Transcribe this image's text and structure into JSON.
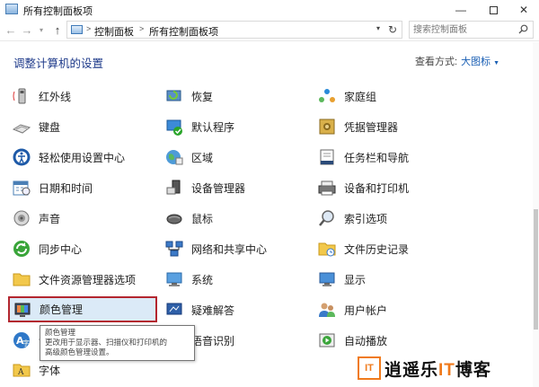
{
  "window": {
    "title": "所有控制面板项"
  },
  "address": {
    "crumbs": [
      "控制面板",
      "所有控制面板项"
    ],
    "search_placeholder": "搜索控制面板"
  },
  "header": {
    "title": "调整计算机的设置",
    "view_label": "查看方式:",
    "view_value": "大图标"
  },
  "items": [
    {
      "label": "红外线",
      "icon": "infrared-icon"
    },
    {
      "label": "恢复",
      "icon": "recovery-icon"
    },
    {
      "label": "家庭组",
      "icon": "homegroup-icon"
    },
    {
      "label": "键盘",
      "icon": "keyboard-icon"
    },
    {
      "label": "默认程序",
      "icon": "default-programs-icon"
    },
    {
      "label": "凭据管理器",
      "icon": "credential-manager-icon"
    },
    {
      "label": "轻松使用设置中心",
      "icon": "ease-of-access-icon"
    },
    {
      "label": "区域",
      "icon": "region-icon"
    },
    {
      "label": "任务栏和导航",
      "icon": "taskbar-icon"
    },
    {
      "label": "日期和时间",
      "icon": "date-time-icon"
    },
    {
      "label": "设备管理器",
      "icon": "device-manager-icon"
    },
    {
      "label": "设备和打印机",
      "icon": "devices-printers-icon"
    },
    {
      "label": "声音",
      "icon": "sound-icon"
    },
    {
      "label": "鼠标",
      "icon": "mouse-icon"
    },
    {
      "label": "索引选项",
      "icon": "indexing-icon"
    },
    {
      "label": "同步中心",
      "icon": "sync-center-icon"
    },
    {
      "label": "网络和共享中心",
      "icon": "network-icon"
    },
    {
      "label": "文件历史记录",
      "icon": "file-history-icon"
    },
    {
      "label": "文件资源管理器选项",
      "icon": "explorer-options-icon"
    },
    {
      "label": "系统",
      "icon": "system-icon"
    },
    {
      "label": "显示",
      "icon": "display-icon"
    },
    {
      "label": "颜色管理",
      "icon": "color-management-icon"
    },
    {
      "label": "疑难解答",
      "icon": "troubleshooting-icon"
    },
    {
      "label": "用户帐户",
      "icon": "user-accounts-icon"
    },
    {
      "label": "语言",
      "icon": "language-icon"
    },
    {
      "label": "语音识别",
      "icon": "speech-recognition-icon"
    },
    {
      "label": "自动播放",
      "icon": "autoplay-icon"
    },
    {
      "label": "字体",
      "icon": "fonts-icon"
    }
  ],
  "tooltip": {
    "lines": [
      "颜色管理",
      "更改用于显示器、扫描仪和打印机的",
      "高级颜色管理设置。"
    ]
  },
  "watermark": {
    "mark": "IT",
    "text_a": "逍遥乐",
    "text_it": "IT",
    "text_b": "博客"
  },
  "colors": {
    "selection_border": "#b3262f",
    "selection_fill": "#dbeaf7",
    "heading": "#1e3a8a",
    "link": "#1a5fb4"
  }
}
